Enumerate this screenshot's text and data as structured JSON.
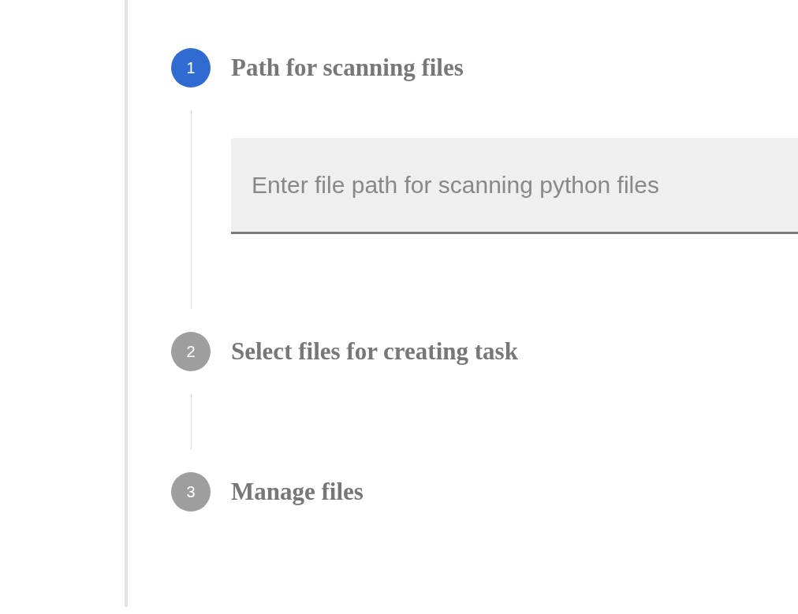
{
  "steps": [
    {
      "number": "1",
      "title": "Path for scanning files",
      "selected": true,
      "field": {
        "placeholder": "Enter file path for scanning python files"
      }
    },
    {
      "number": "2",
      "title": "Select files for creating task",
      "selected": false
    },
    {
      "number": "3",
      "title": "Manage files",
      "selected": false
    }
  ]
}
